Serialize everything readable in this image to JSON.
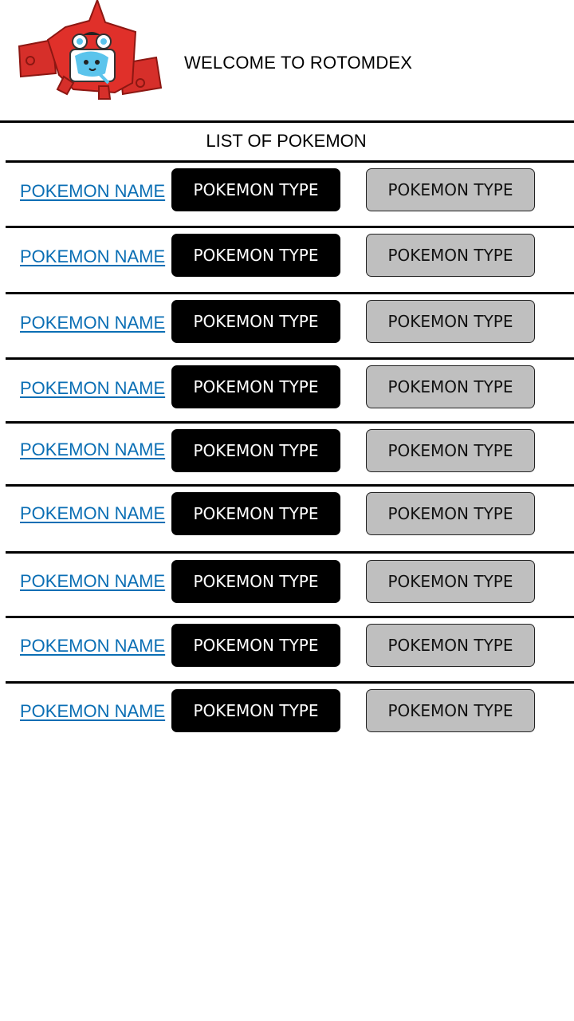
{
  "header": {
    "welcome_text": "WELCOME TO ROTOMDEX",
    "logo_icon": "rotom-dex-icon"
  },
  "list": {
    "title": "LIST OF POKEMON",
    "rows": [
      {
        "name": "POKEMON NAME",
        "type1": "POKEMON TYPE",
        "type2": "POKEMON TYPE"
      },
      {
        "name": "POKEMON NAME",
        "type1": "POKEMON TYPE",
        "type2": "POKEMON TYPE"
      },
      {
        "name": "POKEMON NAME",
        "type1": "POKEMON TYPE",
        "type2": "POKEMON TYPE"
      },
      {
        "name": "POKEMON NAME",
        "type1": "POKEMON TYPE",
        "type2": "POKEMON TYPE"
      },
      {
        "name": "POKEMON NAME",
        "type1": "POKEMON TYPE",
        "type2": "POKEMON TYPE"
      },
      {
        "name": "POKEMON NAME",
        "type1": "POKEMON TYPE",
        "type2": "POKEMON TYPE"
      },
      {
        "name": "POKEMON NAME",
        "type1": "POKEMON TYPE",
        "type2": "POKEMON TYPE"
      },
      {
        "name": "POKEMON NAME",
        "type1": "POKEMON TYPE",
        "type2": "POKEMON TYPE"
      },
      {
        "name": "POKEMON NAME",
        "type1": "POKEMON TYPE",
        "type2": "POKEMON TYPE"
      }
    ]
  },
  "colors": {
    "link": "#0a6eb4",
    "primary_type_bg": "#000000",
    "secondary_type_bg": "#bfbfbf",
    "logo_red": "#e0302a",
    "logo_blue": "#5bc4ec"
  }
}
